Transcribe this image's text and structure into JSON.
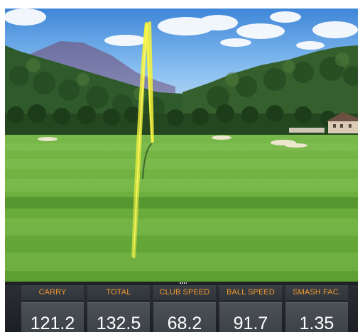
{
  "stats": [
    {
      "label": "CARRY",
      "value": "121.2"
    },
    {
      "label": "TOTAL",
      "value": "132.5"
    },
    {
      "label": "CLUB SPEED",
      "value": "68.2"
    },
    {
      "label": "BALL SPEED",
      "value": "91.7"
    },
    {
      "label": "SMASH FAC.",
      "value": "1.35"
    }
  ],
  "colors": {
    "stat_label": "#f29a2c",
    "stat_value": "#ffffff",
    "panel": "#2a2e33",
    "ball_trace": "#f4f23a",
    "sky": "#5f9fe0",
    "fairway": "#6fb23e"
  },
  "icons": {
    "panel_grip": "grip-dots-icon"
  }
}
